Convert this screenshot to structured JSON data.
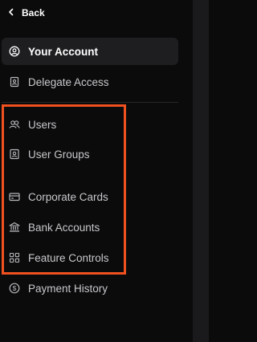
{
  "back": {
    "label": "Back",
    "icon": "chevron-left-icon"
  },
  "nav": {
    "your_account": {
      "label": "Your Account",
      "icon": "user-circle-icon"
    },
    "delegate_access": {
      "label": "Delegate Access",
      "icon": "badge-icon"
    },
    "users": {
      "label": "Users",
      "icon": "users-icon"
    },
    "user_groups": {
      "label": "User Groups",
      "icon": "user-square-icon"
    },
    "corporate_cards": {
      "label": "Corporate Cards",
      "icon": "card-icon"
    },
    "bank_accounts": {
      "label": "Bank Accounts",
      "icon": "bank-icon"
    },
    "feature_controls": {
      "label": "Feature Controls",
      "icon": "grid-icon"
    },
    "payment_history": {
      "label": "Payment History",
      "icon": "dollar-circle-icon"
    }
  },
  "colors": {
    "background": "#0b0b0c",
    "active_item": "#1e1e21",
    "highlight_border": "#f0511f",
    "text": "#c8c8cc",
    "text_active": "#ffffff"
  }
}
